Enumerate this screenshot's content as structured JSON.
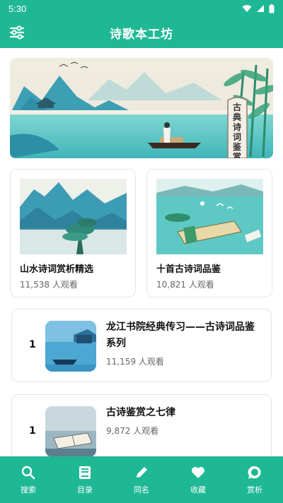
{
  "status_bar": {
    "time": "5:30"
  },
  "app_bar": {
    "title": "诗歌本工坊",
    "menu_icon": "sliders-icon"
  },
  "banner": {
    "scroll_text": "古典诗词鉴赏"
  },
  "cards": [
    {
      "title": "山水诗词赏析精选",
      "views": "11,538 人观看"
    },
    {
      "title": "十首古诗词品鉴",
      "views": "10,821 人观看"
    }
  ],
  "list": [
    {
      "rank": "1",
      "title": "龙江书院经典传习——古诗词品鉴系列",
      "views": "11,159 人观看"
    },
    {
      "rank": "1",
      "title": "古诗鉴赏之七律",
      "views": "9,872 人观看"
    }
  ],
  "nav": [
    {
      "label": "搜索",
      "icon": "search-icon"
    },
    {
      "label": "目录",
      "icon": "book-icon"
    },
    {
      "label": "同名",
      "icon": "pencil-icon"
    },
    {
      "label": "收藏",
      "icon": "heart-icon"
    },
    {
      "label": "赏析",
      "icon": "chat-bubble-icon"
    }
  ],
  "colors": {
    "primary": "#1fb895",
    "teal_water": "#5bc9c8",
    "mountain": "#2f8fa7"
  }
}
